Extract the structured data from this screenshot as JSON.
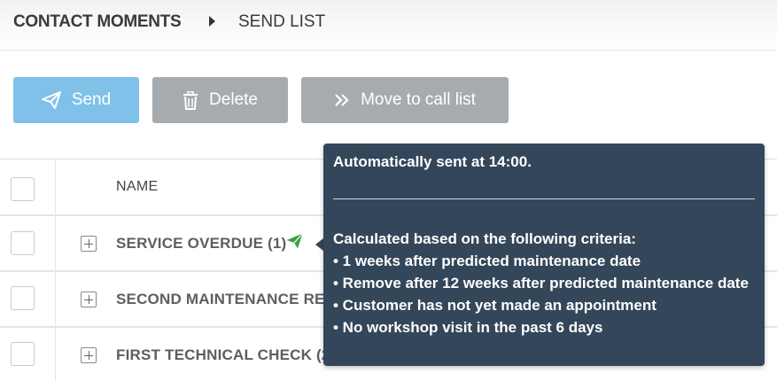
{
  "breadcrumb": {
    "section": "CONTACT MOMENTS",
    "current": "SEND LIST"
  },
  "toolbar": {
    "send_label": "Send",
    "delete_label": "Delete",
    "move_label": "Move to call list"
  },
  "table": {
    "column_name": "NAME",
    "rows": [
      {
        "name": "SERVICE OVERDUE (1)"
      },
      {
        "name": "SECOND MAINTENANCE RE"
      },
      {
        "name": "FIRST TECHNICAL CHECK (2"
      }
    ]
  },
  "tooltip": {
    "title": "Automatically sent at 14:00.",
    "criteria_heading": "Calculated based on the following criteria:",
    "criteria": [
      "• 1 weeks after predicted maintenance date",
      "• Remove after 12 weeks after predicted maintenance date",
      "• Customer has not yet made an appointment",
      "• No workshop visit in the past 6 days"
    ]
  },
  "icons": {
    "send": "paper-plane-icon",
    "delete": "trash-icon",
    "move": "double-chevron-right-icon",
    "sent_status": "paper-plane-icon"
  },
  "colors": {
    "send_button": "#7fc1e8",
    "disabled_button": "#a6abb0",
    "tooltip_bg": "#34465a",
    "sent_icon": "#3aa04a"
  }
}
